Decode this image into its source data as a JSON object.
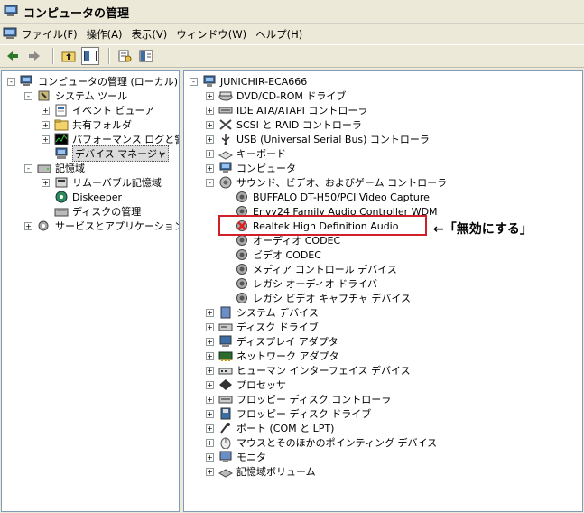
{
  "window": {
    "title": "コンピュータの管理"
  },
  "menu": [
    "ファイル(F)",
    "操作(A)",
    "表示(V)",
    "ウィンドウ(W)",
    "ヘルプ(H)"
  ],
  "left_tree": [
    {
      "label": "コンピュータの管理 (ローカル)",
      "icon": "computer-manage-icon",
      "level": 0,
      "exp": "-"
    },
    {
      "label": "システム ツール",
      "icon": "tools-icon",
      "level": 1,
      "exp": "-"
    },
    {
      "label": "イベント ビューア",
      "icon": "event-viewer-icon",
      "level": 2,
      "exp": "+"
    },
    {
      "label": "共有フォルダ",
      "icon": "folder-icon",
      "level": 2,
      "exp": "+"
    },
    {
      "label": "パフォーマンス ログと警告",
      "icon": "performance-icon",
      "level": 2,
      "exp": "+"
    },
    {
      "label": "デバイス マネージャ",
      "icon": "device-manager-icon",
      "level": 2,
      "exp": "",
      "selected": true
    },
    {
      "label": "記憶域",
      "icon": "storage-icon",
      "level": 1,
      "exp": "-"
    },
    {
      "label": "リムーバブル記憶域",
      "icon": "removable-storage-icon",
      "level": 2,
      "exp": "+"
    },
    {
      "label": "Diskeeper",
      "icon": "diskeeper-icon",
      "level": 2,
      "exp": ""
    },
    {
      "label": "ディスクの管理",
      "icon": "disk-management-icon",
      "level": 2,
      "exp": ""
    },
    {
      "label": "サービスとアプリケーション",
      "icon": "services-icon",
      "level": 1,
      "exp": "+"
    }
  ],
  "right_tree": [
    {
      "label": "JUNICHIR-ECA666",
      "icon": "computer-icon",
      "level": 0,
      "exp": "-"
    },
    {
      "label": "DVD/CD-ROM ドライブ",
      "icon": "dvd-icon",
      "level": 1,
      "exp": "+"
    },
    {
      "label": "IDE ATA/ATAPI コントローラ",
      "icon": "ide-icon",
      "level": 1,
      "exp": "+"
    },
    {
      "label": "SCSI と RAID コントローラ",
      "icon": "scsi-icon",
      "level": 1,
      "exp": "+"
    },
    {
      "label": "USB (Universal Serial Bus) コントローラ",
      "icon": "usb-icon",
      "level": 1,
      "exp": "+"
    },
    {
      "label": "キーボード",
      "icon": "keyboard-icon",
      "level": 1,
      "exp": "+"
    },
    {
      "label": "コンピュータ",
      "icon": "computer-icon",
      "level": 1,
      "exp": "+"
    },
    {
      "label": "サウンド、ビデオ、およびゲーム コントローラ",
      "icon": "sound-icon",
      "level": 1,
      "exp": "-"
    },
    {
      "label": "BUFFALO DT-H50/PCI Video Capture",
      "icon": "sound-device-icon",
      "level": 2,
      "exp": ""
    },
    {
      "label": "Envy24 Family Audio Controller WDM",
      "icon": "sound-device-icon",
      "level": 2,
      "exp": ""
    },
    {
      "label": "Realtek High Definition Audio",
      "icon": "disabled-device-icon",
      "level": 2,
      "exp": ""
    },
    {
      "label": "オーディオ CODEC",
      "icon": "sound-device-icon",
      "level": 2,
      "exp": ""
    },
    {
      "label": "ビデオ CODEC",
      "icon": "sound-device-icon",
      "level": 2,
      "exp": ""
    },
    {
      "label": "メディア コントロール デバイス",
      "icon": "sound-device-icon",
      "level": 2,
      "exp": ""
    },
    {
      "label": "レガシ オーディオ ドライバ",
      "icon": "sound-device-icon",
      "level": 2,
      "exp": ""
    },
    {
      "label": "レガシ ビデオ キャプチャ デバイス",
      "icon": "sound-device-icon",
      "level": 2,
      "exp": ""
    },
    {
      "label": "システム デバイス",
      "icon": "system-device-icon",
      "level": 1,
      "exp": "+"
    },
    {
      "label": "ディスク ドライブ",
      "icon": "disk-drive-icon",
      "level": 1,
      "exp": "+"
    },
    {
      "label": "ディスプレイ アダプタ",
      "icon": "display-icon",
      "level": 1,
      "exp": "+"
    },
    {
      "label": "ネットワーク アダプタ",
      "icon": "network-icon",
      "level": 1,
      "exp": "+"
    },
    {
      "label": "ヒューマン インターフェイス デバイス",
      "icon": "hid-icon",
      "level": 1,
      "exp": "+"
    },
    {
      "label": "プロセッサ",
      "icon": "processor-icon",
      "level": 1,
      "exp": "+"
    },
    {
      "label": "フロッピー ディスク コントローラ",
      "icon": "floppy-controller-icon",
      "level": 1,
      "exp": "+"
    },
    {
      "label": "フロッピー ディスク ドライブ",
      "icon": "floppy-drive-icon",
      "level": 1,
      "exp": "+"
    },
    {
      "label": "ポート (COM と LPT)",
      "icon": "port-icon",
      "level": 1,
      "exp": "+"
    },
    {
      "label": "マウスとそのほかのポインティング デバイス",
      "icon": "mouse-icon",
      "level": 1,
      "exp": "+"
    },
    {
      "label": "モニタ",
      "icon": "monitor-icon",
      "level": 1,
      "exp": "+"
    },
    {
      "label": "記憶域ボリューム",
      "icon": "volume-icon",
      "level": 1,
      "exp": "+"
    }
  ],
  "annotation": {
    "text": "←「無効にする」",
    "color": "#d0202a"
  },
  "colors": {
    "pane_border": "#7f9db9",
    "window_bg": "#ece9d8",
    "selection": "#dcdcdc"
  }
}
